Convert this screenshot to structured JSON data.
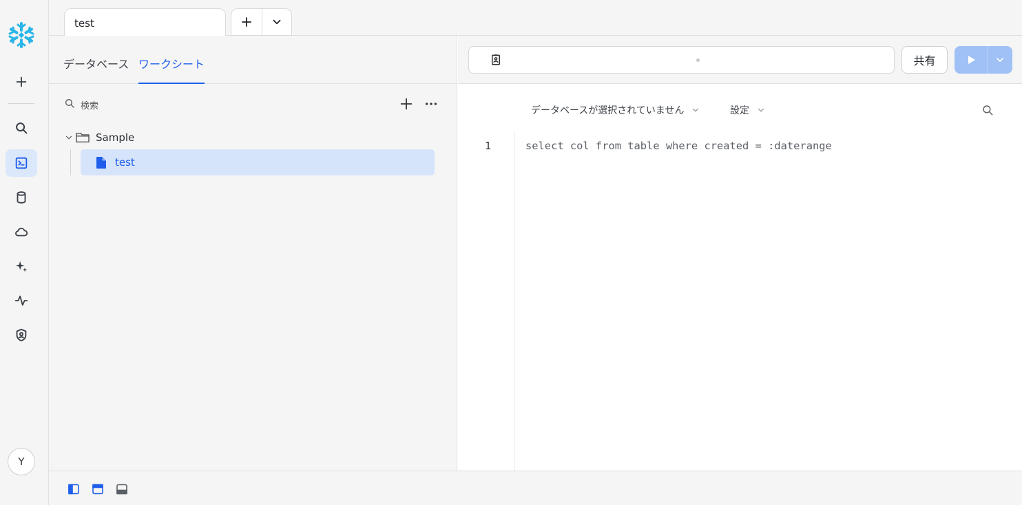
{
  "tabs": {
    "items": [
      {
        "label": "test"
      }
    ]
  },
  "sidebar": {
    "avatar_initial": "Y",
    "icons": [
      "create-icon",
      "search-icon",
      "projects-icon",
      "data-icon",
      "data-products-icon",
      "ai-ml-icon",
      "monitoring-icon",
      "admin-icon"
    ]
  },
  "left_pane": {
    "tabs": [
      {
        "label": "データベース"
      },
      {
        "label": "ワークシート"
      }
    ],
    "search_label": "検索",
    "tree": {
      "folder": "Sample",
      "items": [
        {
          "label": "test"
        }
      ]
    }
  },
  "toolbar": {
    "share_label": "共有"
  },
  "editor": {
    "database_select": "データベースが選択されていません",
    "settings_label": "設定",
    "lines": [
      {
        "number": "1",
        "code": "select col from table where created = :daterange"
      }
    ]
  },
  "colors": {
    "accent": "#1e5eea",
    "selected_bg": "#d6e4fb",
    "run_button": "#9fc1f5",
    "logo": "#29b5e8"
  }
}
